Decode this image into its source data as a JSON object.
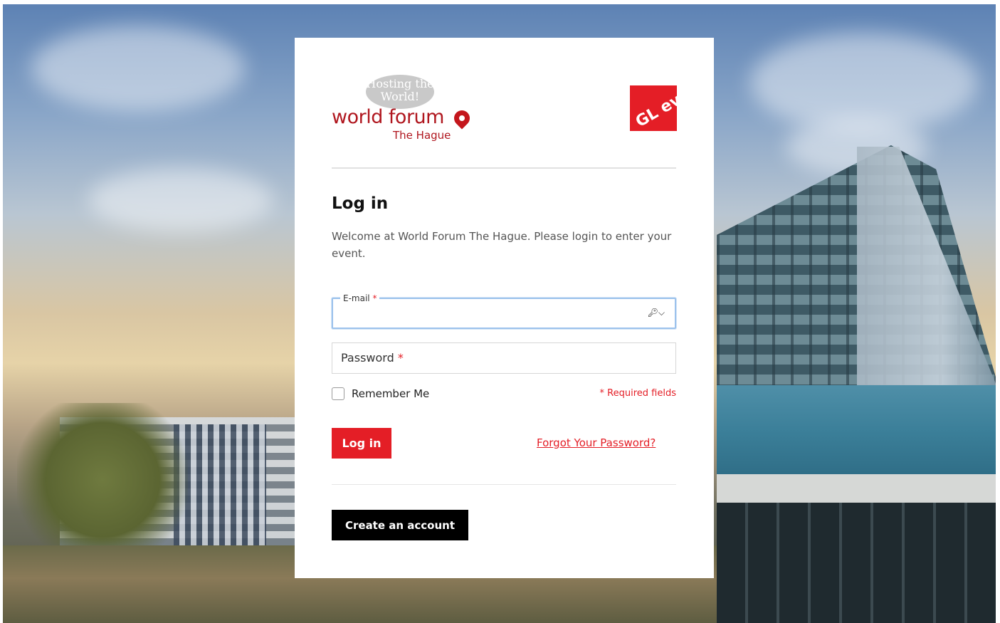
{
  "logos": {
    "hosting_badge": "Hosting the World!",
    "world_forum": "world forum",
    "the_hague": "The Hague",
    "gl_events": "GL events"
  },
  "login": {
    "title": "Log in",
    "welcome": "Welcome at World Forum The Hague. Please login to enter your event.",
    "email_label": "E-mail",
    "password_label": "Password",
    "required_marker": "*",
    "remember_me": "Remember Me",
    "required_fields": "* Required fields",
    "login_button": "Log in",
    "forgot_password": "Forgot Your Password?",
    "create_account": "Create an account"
  },
  "colors": {
    "accent_red": "#e41e26",
    "brand_red": "#b0171f",
    "black": "#000000"
  }
}
